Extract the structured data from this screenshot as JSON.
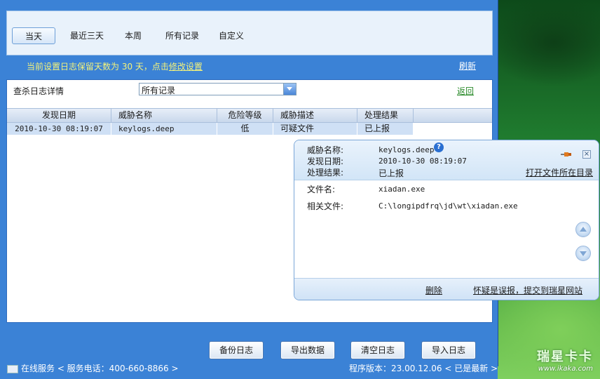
{
  "tabs": [
    {
      "label": "当天",
      "active": true
    },
    {
      "label": "最近三天",
      "active": false
    },
    {
      "label": "本周",
      "active": false
    },
    {
      "label": "所有记录",
      "active": false
    },
    {
      "label": "自定义",
      "active": false
    }
  ],
  "notice": {
    "text": "当前设置日志保留天数为 30 天，点击",
    "link": "修改设置"
  },
  "refresh_label": "刷新",
  "filter": {
    "label": "查杀日志详情",
    "selected": "所有记录",
    "back_label": "返回"
  },
  "table": {
    "headers": [
      "发现日期",
      "威胁名称",
      "危险等级",
      "威胁描述",
      "处理结果"
    ],
    "rows": [
      [
        "2010-10-30 08:19:07",
        "keylogs.deep",
        "低",
        "可疑文件",
        "已上报"
      ]
    ]
  },
  "popup": {
    "threat_label": "威胁名称:",
    "threat_value": "keylogs.deep",
    "date_label": "发现日期:",
    "date_value": "2010-10-30 08:19:07",
    "result_label": "处理结果:",
    "result_value": "已上报",
    "open_dir": "打开文件所在目录",
    "filename_label": "文件名:",
    "filename_value": "xiadan.exe",
    "related_label": "相关文件:",
    "related_value": "C:\\longipdfrq\\jd\\wt\\xiadan.exe",
    "delete_label": "删除",
    "report_label": "怀疑是误报，提交到瑞星网站",
    "help_icon": "?",
    "close_icon": "×"
  },
  "buttons": {
    "backup": "备份日志",
    "export": "导出数据",
    "clear": "清空日志",
    "import": "导入日志"
  },
  "status": {
    "left": "在线服务 < 服务电话：400-660-8866 >",
    "right": "程序版本：23.00.12.06 < 已是最新 >"
  },
  "watermark": {
    "big": "瑞星卡卡",
    "small": "www.ikaka.com"
  },
  "colors": {
    "window_blue": "#3b82d6",
    "notice_yellow": "#f4f27a",
    "row_selected": "#cfe0f5",
    "link_green": "#2a8a2a"
  }
}
